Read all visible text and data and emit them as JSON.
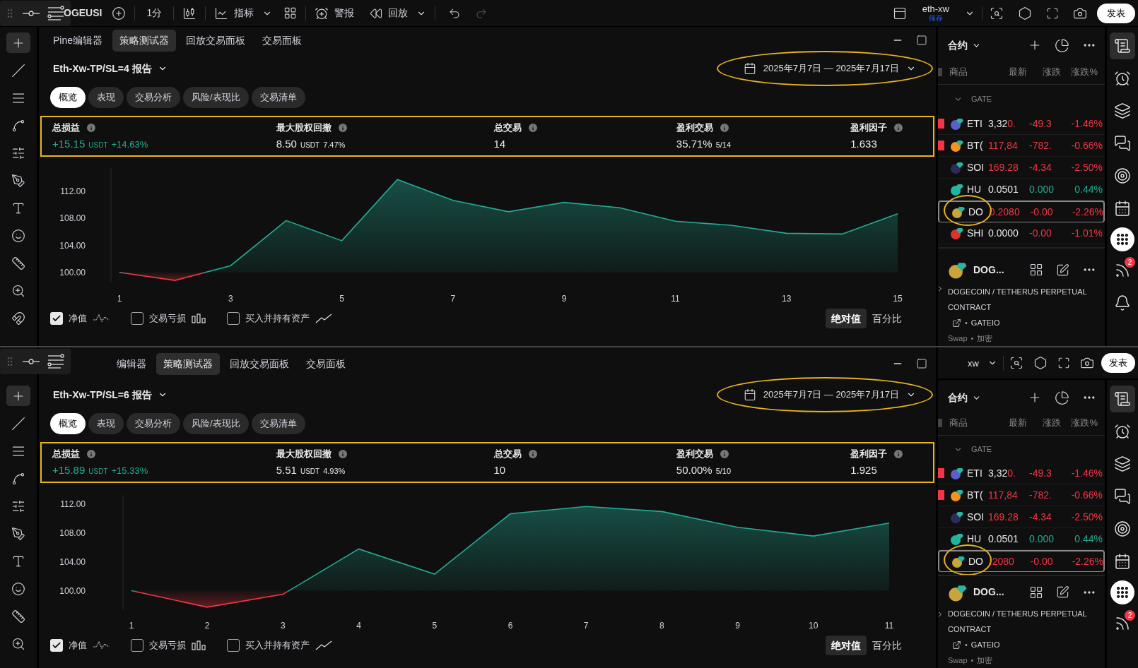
{
  "screens": [
    {
      "toolbar": {
        "kind": "full",
        "symbol": "OGEUSI",
        "interval": "1分",
        "indicators": "指标",
        "alerts": "警报",
        "replay": "回放",
        "layout_name": "eth-xw",
        "save_status": "保存",
        "publish": "发表"
      },
      "drawing_tools": [
        {
          "kind": "crosshair",
          "selected": true
        },
        {
          "kind": "line",
          "selected": false
        },
        {
          "kind": "fib",
          "selected": false
        },
        {
          "kind": "pattern",
          "selected": false
        },
        {
          "kind": "forecast",
          "selected": false
        },
        {
          "kind": "brush",
          "selected": false
        },
        {
          "kind": "text",
          "selected": false
        },
        {
          "kind": "emoji",
          "selected": false
        },
        {
          "kind": "ruler",
          "selected": false
        },
        {
          "kind": "zoom",
          "selected": false
        },
        {
          "kind": "magnet",
          "selected": false
        }
      ],
      "tabs": [
        {
          "label": "Pine编辑器",
          "selected": false
        },
        {
          "label": "策略测试器",
          "selected": true
        },
        {
          "label": "回放交易面板",
          "selected": false
        },
        {
          "label": "交易面板",
          "selected": false
        }
      ],
      "report_title": "Eth-Xw-TP/SL=4 报告",
      "date_range": {
        "text": "2025年7月7日 — 2025年7月17日",
        "highlighted": true
      },
      "subtabs": [
        {
          "label": "概览",
          "selected": true
        },
        {
          "label": "表现",
          "selected": false
        },
        {
          "label": "交易分析",
          "selected": false
        },
        {
          "label": "风险/表现比",
          "selected": false
        },
        {
          "label": "交易清单",
          "selected": false
        }
      ],
      "stats": {
        "highlighted": true,
        "items": [
          {
            "label": "总损益",
            "value": "+15.15",
            "unit": "USDT",
            "extra": "+14.63%",
            "positive": true
          },
          {
            "label": "最大股权回撤",
            "value": "8.50",
            "unit": "USDT",
            "extra": "7.47%",
            "positive": false
          },
          {
            "label": "总交易",
            "value": "14",
            "positive": false
          },
          {
            "label": "盈利交易",
            "value": "35.71%",
            "extra": "5/14",
            "positive": false
          },
          {
            "label": "盈利因子",
            "value": "1.633",
            "positive": false
          }
        ]
      },
      "chart_data": {
        "type": "area",
        "x": [
          1,
          2,
          3,
          4,
          5,
          6,
          7,
          8,
          9,
          10,
          11,
          12,
          13,
          14,
          15
        ],
        "series": [
          {
            "name": "净值",
            "color": "#22ab94",
            "values": [
              100.0,
              98.8,
              101.0,
              107.7,
              104.7,
              113.8,
              110.7,
              109.0,
              110.4,
              109.6,
              107.6,
              107.0,
              105.8,
              105.7,
              108.7
            ]
          }
        ],
        "xlim": [
          1,
          15
        ],
        "ylim": [
          98.5,
          115.5
        ],
        "xticks": [
          1,
          3,
          5,
          7,
          9,
          11,
          13,
          15
        ],
        "yticks": [
          {
            "value": 100,
            "label": "100.00"
          },
          {
            "value": 104,
            "label": "104.00"
          },
          {
            "value": 108,
            "label": "108.00"
          },
          {
            "value": 112,
            "label": "112.00"
          }
        ]
      },
      "legend": [
        {
          "kind": "equity",
          "checked": true
        },
        {
          "kind": "trades",
          "label": "交易亏损",
          "checked": false
        },
        {
          "kind": "buyhold",
          "label": "买入并持有资产",
          "checked": false
        }
      ],
      "scale_modes": [
        {
          "label": "绝对值",
          "selected": true
        },
        {
          "label": "百分比",
          "selected": false
        }
      ],
      "watchlist": {
        "title": "合约",
        "columns": [
          "商品",
          "最新",
          "涨跌",
          "涨跌%"
        ],
        "group": "GATE",
        "rows": [
          {
            "flagged": true,
            "color": "#5b5fc7",
            "symbol": "ETI",
            "last": [
              {
                "text": "3,32",
                "flash": false
              },
              {
                "text": "0.",
                "flash": true
              }
            ],
            "change": "-49.3",
            "change_pct": "-1.46%",
            "rising": false,
            "selected": false,
            "circled": false
          },
          {
            "flagged": true,
            "color": "#f7931a",
            "symbol": "BT(",
            "last": [
              {
                "text": "117,84",
                "flash": true
              }
            ],
            "change": "-782.",
            "change_pct": "-0.66%",
            "rising": false,
            "selected": false,
            "circled": false
          },
          {
            "flagged": false,
            "color": "#2c2c5a",
            "symbol": "SOI",
            "last": [
              {
                "text": "169.28",
                "flash": true
              }
            ],
            "change": "-4.34",
            "change_pct": "-2.50%",
            "rising": false,
            "selected": false,
            "circled": false
          },
          {
            "flagged": false,
            "color": "#1fb5a0",
            "symbol": "HU",
            "last": [
              {
                "text": "0.0501",
                "flash": false
              }
            ],
            "change": "0.000",
            "change_pct": "0.44%",
            "rising": true,
            "selected": false,
            "circled": false
          },
          {
            "flagged": false,
            "color": "#c8a43a",
            "symbol": "DO",
            "last": [
              {
                "text": "0.2080",
                "flash": true
              }
            ],
            "change": "-0.00",
            "change_pct": "-2.26%",
            "rising": false,
            "selected": true,
            "circled": true
          },
          {
            "flagged": false,
            "color": "#e0312b",
            "symbol": "SHI",
            "last": [
              {
                "text": "0.0000",
                "flash": false
              }
            ],
            "change": "-0.00",
            "change_pct": "-1.01%",
            "rising": false,
            "selected": false,
            "circled": false
          }
        ]
      },
      "symbol_detail": {
        "short_name": "DOG...",
        "description": "DOGECOIN / TETHERUS PERPETUAL CONTRACT",
        "separator_1": "•",
        "exchange": "GATEIO",
        "type": "Swap",
        "separator_2": "•",
        "category": "加密"
      },
      "side_buttons": [
        {
          "kind": "watchlist",
          "selected": true
        },
        {
          "kind": "alarm",
          "selected": false
        },
        {
          "kind": "layers",
          "selected": false
        },
        {
          "kind": "chat",
          "selected": false
        },
        {
          "kind": "target",
          "selected": false
        },
        {
          "kind": "calendar",
          "selected": false
        },
        {
          "kind": "apps",
          "selected": false
        },
        {
          "kind": "signals",
          "selected": false,
          "badge": "2"
        },
        {
          "kind": "bell",
          "selected": false
        }
      ]
    },
    {
      "toolbar": {
        "kind": "partial",
        "layout_name": "xw",
        "publish": "发表"
      },
      "drawing_tools": [
        {
          "kind": "crosshair",
          "selected": true
        },
        {
          "kind": "line",
          "selected": false
        },
        {
          "kind": "fib",
          "selected": false
        },
        {
          "kind": "pattern",
          "selected": false
        },
        {
          "kind": "forecast",
          "selected": false
        },
        {
          "kind": "brush",
          "selected": false
        },
        {
          "kind": "text",
          "selected": false
        },
        {
          "kind": "emoji",
          "selected": false
        },
        {
          "kind": "ruler",
          "selected": false
        },
        {
          "kind": "zoom",
          "selected": false
        }
      ],
      "tabs": [
        {
          "label": "编辑器",
          "selected": false
        },
        {
          "label": "策略测试器",
          "selected": true
        },
        {
          "label": "回放交易面板",
          "selected": false
        },
        {
          "label": "交易面板",
          "selected": false
        }
      ],
      "report_title": "Eth-Xw-TP/SL=6 报告",
      "date_range": {
        "text": "2025年7月7日 — 2025年7月17日",
        "highlighted": true
      },
      "subtabs": [
        {
          "label": "概览",
          "selected": true
        },
        {
          "label": "表现",
          "selected": false
        },
        {
          "label": "交易分析",
          "selected": false
        },
        {
          "label": "风险/表现比",
          "selected": false
        },
        {
          "label": "交易清单",
          "selected": false
        }
      ],
      "stats": {
        "highlighted": true,
        "items": [
          {
            "label": "总损益",
            "value": "+15.89",
            "unit": "USDT",
            "extra": "+15.33%",
            "positive": true
          },
          {
            "label": "最大股权回撤",
            "value": "5.51",
            "unit": "USDT",
            "extra": "4.93%",
            "positive": false
          },
          {
            "label": "总交易",
            "value": "10",
            "positive": false
          },
          {
            "label": "盈利交易",
            "value": "50.00%",
            "extra": "5/10",
            "positive": false
          },
          {
            "label": "盈利因子",
            "value": "1.925",
            "positive": false
          }
        ]
      },
      "chart_data": {
        "type": "area",
        "x": [
          1,
          2,
          3,
          4,
          5,
          6,
          7,
          8,
          9,
          10,
          11
        ],
        "series": [
          {
            "name": "净值",
            "color": "#22ab94",
            "values": [
              100.0,
              97.7,
              99.5,
              105.8,
              102.3,
              110.7,
              111.7,
              111.0,
              108.8,
              107.6,
              109.4
            ]
          }
        ],
        "xlim": [
          1,
          11
        ],
        "ylim": [
          97.4,
          113.3
        ],
        "xticks": [
          1,
          2,
          3,
          4,
          5,
          6,
          7,
          8,
          9,
          10,
          11
        ],
        "yticks": [
          {
            "value": 100,
            "label": "100.00"
          },
          {
            "value": 104,
            "label": "104.00"
          },
          {
            "value": 108,
            "label": "108.00"
          },
          {
            "value": 112,
            "label": "112.00"
          }
        ]
      },
      "legend": [
        {
          "kind": "equity",
          "checked": true
        },
        {
          "kind": "trades",
          "label": "交易亏损",
          "checked": false
        },
        {
          "kind": "buyhold",
          "label": "买入并持有资产",
          "checked": false
        }
      ],
      "scale_modes": [
        {
          "label": "绝对值",
          "selected": true
        },
        {
          "label": "百分比",
          "selected": false
        }
      ],
      "watchlist": {
        "title": "合约",
        "columns": [
          "商品",
          "最新",
          "涨跌",
          "涨跌%"
        ],
        "group": "GATE",
        "rows": [
          {
            "flagged": true,
            "color": "#5b5fc7",
            "symbol": "ETI",
            "last": [
              {
                "text": "3,32",
                "flash": false
              },
              {
                "text": "0.",
                "flash": true
              }
            ],
            "change": "-49.3",
            "change_pct": "-1.46%",
            "rising": false,
            "selected": false,
            "circled": false
          },
          {
            "flagged": true,
            "color": "#f7931a",
            "symbol": "BT(",
            "last": [
              {
                "text": "117,84",
                "flash": true
              }
            ],
            "change": "-782.",
            "change_pct": "-0.66%",
            "rising": false,
            "selected": false,
            "circled": false
          },
          {
            "flagged": false,
            "color": "#2c2c5a",
            "symbol": "SOI",
            "last": [
              {
                "text": "169.28",
                "flash": true
              }
            ],
            "change": "-4.34",
            "change_pct": "-2.50%",
            "rising": false,
            "selected": false,
            "circled": false
          },
          {
            "flagged": false,
            "color": "#1fb5a0",
            "symbol": "HU",
            "last": [
              {
                "text": "0.0501",
                "flash": false
              }
            ],
            "change": "0.000",
            "change_pct": "0.44%",
            "rising": true,
            "selected": false,
            "circled": false
          },
          {
            "flagged": false,
            "color": "#c8a43a",
            "symbol": "DO",
            "last": [
              {
                "text": ".2080",
                "flash": true
              }
            ],
            "change": "-0.00",
            "change_pct": "-2.26%",
            "rising": false,
            "selected": true,
            "circled": true
          }
        ]
      },
      "symbol_detail": {
        "short_name": "DOG...",
        "description": "DOGECOIN / TETHERUS PERPETUAL CONTRACT",
        "separator_1": "•",
        "exchange": "GATEIO",
        "type": "Swap",
        "separator_2": "•",
        "category": "加密"
      },
      "side_buttons": [
        {
          "kind": "watchlist",
          "selected": true
        },
        {
          "kind": "alarm",
          "selected": false
        },
        {
          "kind": "layers",
          "selected": false
        },
        {
          "kind": "chat",
          "selected": false
        },
        {
          "kind": "target",
          "selected": false
        },
        {
          "kind": "calendar",
          "selected": false
        },
        {
          "kind": "apps",
          "selected": false
        },
        {
          "kind": "signals",
          "selected": false,
          "badge": "2"
        }
      ]
    }
  ]
}
